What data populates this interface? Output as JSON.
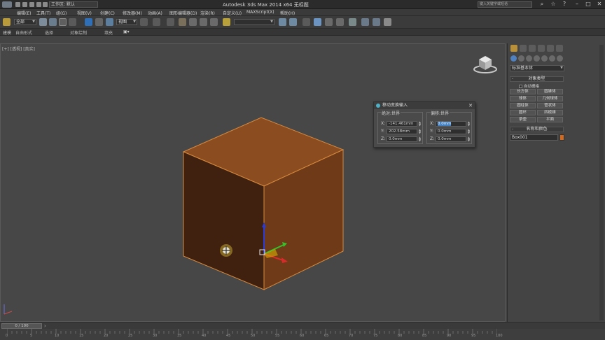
{
  "titlebar": {
    "workspace": "工作区: 默认",
    "title": "Autodesk 3ds Max  2014 x64    无标题",
    "search_placeholder": "键入关键字或短语"
  },
  "menu": {
    "items": [
      "编辑(E)",
      "工具(T)",
      "组(G)",
      "视图(V)",
      "创建(C)",
      "修改器(M)",
      "动画(A)",
      "图形编辑器(D)",
      "渲染(R)",
      "自定义(U)",
      "MAXScript(X)",
      "帮助(H)"
    ]
  },
  "toolbar": {
    "selection_filter": "全部",
    "reference_coord": "视图",
    "named_selection": ""
  },
  "ribbon": {
    "tabs": [
      "建模",
      "自由形式",
      "选择",
      "对象绘制",
      "填充"
    ]
  },
  "viewport": {
    "label": "[+] [透视] [真实]",
    "cube_colors": {
      "top": "#8b4c20",
      "left": "#40200e",
      "right": "#6f3a17",
      "edge": "#d68a3f"
    }
  },
  "dialog": {
    "title": "移动变换输入",
    "absolute_group": "绝对:世界",
    "offset_group": "偏移:世界",
    "absolute": [
      {
        "axis": "X:",
        "value": "-141.461mm"
      },
      {
        "axis": "Y:",
        "value": "202.58mm"
      },
      {
        "axis": "Z:",
        "value": "0.0mm"
      }
    ],
    "offset": [
      {
        "axis": "X:",
        "value": "0.0mm"
      },
      {
        "axis": "Y:",
        "value": "0.0mm"
      },
      {
        "axis": "Z:",
        "value": "0.0mm"
      }
    ]
  },
  "command_panel": {
    "category": "标准基本体",
    "object_type_title": "对象类型",
    "autogrid": "自动栅格",
    "primitives": [
      "长方体",
      "圆锥体",
      "球体",
      "几何球体",
      "圆柱体",
      "管状体",
      "圆环",
      "四棱锥",
      "茶壶",
      "平面"
    ],
    "name_color_title": "名称和颜色",
    "object_name": "Box001",
    "object_color": "#d2691e"
  },
  "timeline": {
    "frame": "0 / 100",
    "tick_labels": [
      "0",
      "5",
      "10",
      "15",
      "20",
      "25",
      "30",
      "35",
      "40",
      "45",
      "50",
      "55",
      "60",
      "65",
      "70",
      "75",
      "80",
      "85",
      "90",
      "95",
      "100"
    ]
  }
}
